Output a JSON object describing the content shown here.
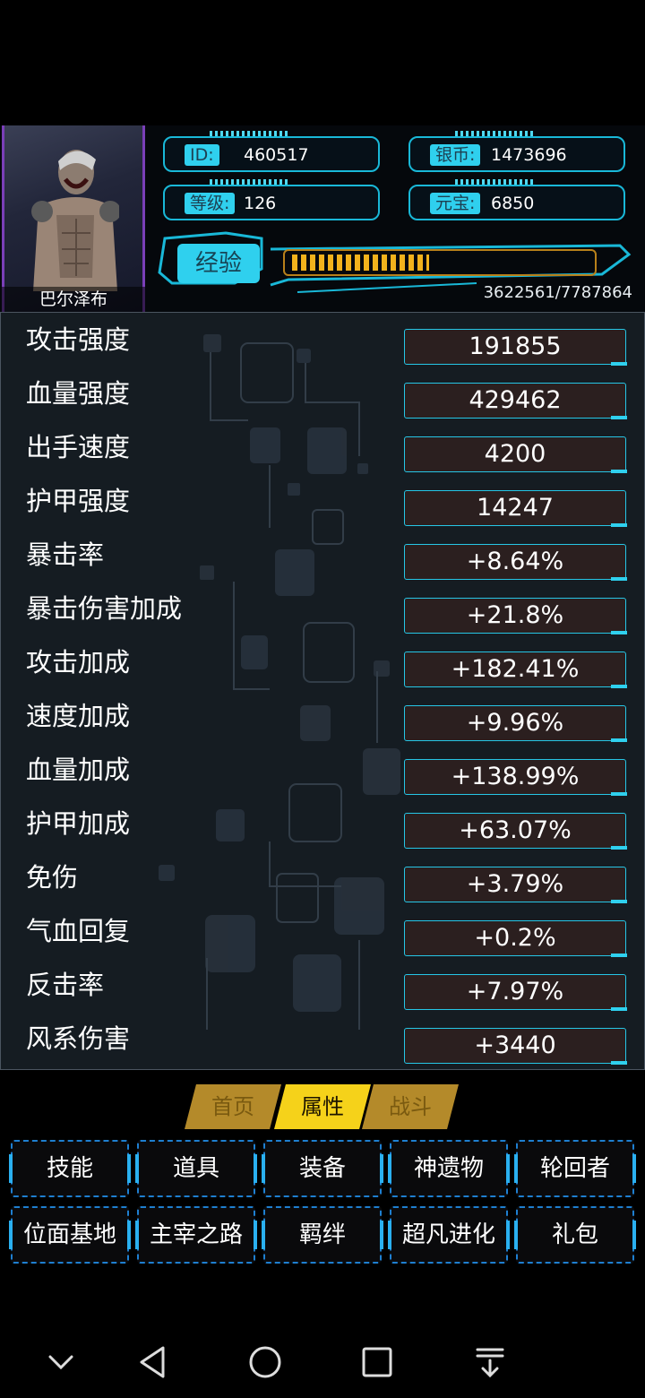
{
  "player": {
    "name": "巴尔泽布",
    "id_label": "ID:",
    "id_value": "460517",
    "level_label": "等级:",
    "level_value": "126",
    "silver_label": "银币:",
    "silver_value": "1473696",
    "ingot_label": "元宝:",
    "ingot_value": "6850",
    "exp_label": "经验",
    "exp_text": "3622561/7787864",
    "exp_fraction": 0.465
  },
  "stats": [
    {
      "label": "攻击强度",
      "value": "191855"
    },
    {
      "label": "血量强度",
      "value": "429462"
    },
    {
      "label": "出手速度",
      "value": "4200"
    },
    {
      "label": "护甲强度",
      "value": "14247"
    },
    {
      "label": "暴击率",
      "value": "+8.64%"
    },
    {
      "label": "暴击伤害加成",
      "value": "+21.8%"
    },
    {
      "label": "攻击加成",
      "value": "+182.41%"
    },
    {
      "label": "速度加成",
      "value": "+9.96%"
    },
    {
      "label": "血量加成",
      "value": "+138.99%"
    },
    {
      "label": "护甲加成",
      "value": "+63.07%"
    },
    {
      "label": "免伤",
      "value": "+3.79%"
    },
    {
      "label": "气血回复",
      "value": "+0.2%"
    },
    {
      "label": "反击率",
      "value": "+7.97%"
    },
    {
      "label": "风系伤害",
      "value": "+3440"
    }
  ],
  "tabs": [
    {
      "label": "首页",
      "active": false
    },
    {
      "label": "属性",
      "active": true
    },
    {
      "label": "战斗",
      "active": false
    }
  ],
  "menu_row1": [
    "技能",
    "道具",
    "装备",
    "神遗物",
    "轮回者"
  ],
  "menu_row2": [
    "位面基地",
    "主宰之路",
    "羁绊",
    "超凡进化",
    "礼包"
  ],
  "nav": [
    "chevron-down-icon",
    "back-triangle-icon",
    "home-circle-icon",
    "recents-square-icon",
    "download-icon"
  ],
  "colors": {
    "accent_cyan": "#2fd0ee",
    "exp_gold": "#f2b21c",
    "stat_value_bg": "#2b1f1f",
    "tab_active": "#f5d21a",
    "tab_inactive": "#b48a2a",
    "menu_border": "#1e7fd0"
  }
}
